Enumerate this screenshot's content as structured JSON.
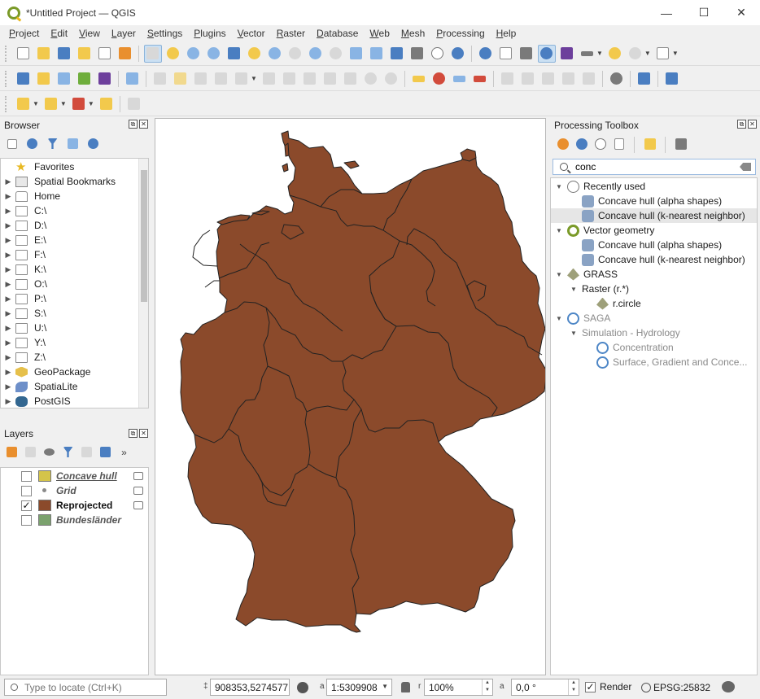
{
  "window": {
    "title": "*Untitled Project — QGIS",
    "minimize": "—",
    "maximize": "☐",
    "close": "✕"
  },
  "menu": [
    "Project",
    "Edit",
    "View",
    "Layer",
    "Settings",
    "Plugins",
    "Vector",
    "Raster",
    "Database",
    "Web",
    "Mesh",
    "Processing",
    "Help"
  ],
  "browser": {
    "title": "Browser",
    "items": [
      {
        "label": "Favorites",
        "icon": "star-icon"
      },
      {
        "label": "Spatial Bookmarks",
        "icon": "bookmark-icon"
      },
      {
        "label": "Home",
        "icon": "home-icon"
      },
      {
        "label": "C:\\",
        "icon": "folder-icon"
      },
      {
        "label": "D:\\",
        "icon": "folder-icon"
      },
      {
        "label": "E:\\",
        "icon": "folder-icon"
      },
      {
        "label": "F:\\",
        "icon": "folder-icon"
      },
      {
        "label": "K:\\",
        "icon": "folder-icon"
      },
      {
        "label": "O:\\",
        "icon": "folder-icon"
      },
      {
        "label": "P:\\",
        "icon": "folder-icon"
      },
      {
        "label": "S:\\",
        "icon": "folder-icon"
      },
      {
        "label": "U:\\",
        "icon": "folder-icon"
      },
      {
        "label": "Y:\\",
        "icon": "folder-icon"
      },
      {
        "label": "Z:\\",
        "icon": "folder-icon"
      },
      {
        "label": "GeoPackage",
        "icon": "geopackage-icon"
      },
      {
        "label": "SpatiaLite",
        "icon": "spatialite-icon"
      },
      {
        "label": "PostGIS",
        "icon": "postgis-icon"
      }
    ]
  },
  "layers": {
    "title": "Layers",
    "items": [
      {
        "name": "Concave hull",
        "checked": false,
        "color": "#d4c44a"
      },
      {
        "name": "Grid",
        "checked": false,
        "color": "#8a8a8a"
      },
      {
        "name": "Reprojected",
        "checked": true,
        "color": "#8b4a2b",
        "checkmark": "✓"
      },
      {
        "name": "Bundesländer",
        "checked": false,
        "color": "#7ba26e"
      }
    ]
  },
  "toolbox": {
    "title": "Processing Toolbox",
    "search": "conc",
    "tree": [
      {
        "label": "Recently used",
        "icon": "clock-icon",
        "level": 0,
        "expanded": true
      },
      {
        "label": "Concave hull (alpha shapes)",
        "icon": "algorithm-icon",
        "level": 1
      },
      {
        "label": "Concave hull (k-nearest neighbor)",
        "icon": "algorithm-icon",
        "level": 1,
        "selected": true
      },
      {
        "label": "Vector geometry",
        "icon": "qgis-icon",
        "level": 0,
        "expanded": true
      },
      {
        "label": "Concave hull (alpha shapes)",
        "icon": "algorithm-icon",
        "level": 1
      },
      {
        "label": "Concave hull (k-nearest neighbor)",
        "icon": "algorithm-icon",
        "level": 1
      },
      {
        "label": "GRASS",
        "icon": "grass-icon",
        "level": 0,
        "expanded": true
      },
      {
        "label": "Raster (r.*)",
        "icon": "",
        "level": 1,
        "expanded": true
      },
      {
        "label": "r.circle",
        "icon": "grass-icon",
        "level": 2
      },
      {
        "label": "SAGA",
        "icon": "saga-icon",
        "level": 0,
        "expanded": true,
        "dim": true
      },
      {
        "label": "Simulation - Hydrology",
        "icon": "",
        "level": 1,
        "expanded": true,
        "dim": true
      },
      {
        "label": "Concentration",
        "icon": "saga-icon",
        "level": 2,
        "dim": true
      },
      {
        "label": "Surface, Gradient and Conce...",
        "icon": "saga-icon",
        "level": 2,
        "dim": true
      }
    ]
  },
  "status": {
    "locate_placeholder": "Type to locate (Ctrl+K)",
    "coordinate": "908353,5274577",
    "scale": "1:5309908",
    "magnifier": "100%",
    "rotation": "0,0 °",
    "render_label": "Render",
    "render_checked": "✓",
    "crs": "EPSG:25832",
    "coord_prefix": "‡",
    "scale_prefix": "a",
    "mag_prefix": "r",
    "rot_prefix": "a"
  },
  "map": {
    "fill": "#8b4a2b",
    "stroke": "#222222",
    "background": "#ffffff"
  }
}
